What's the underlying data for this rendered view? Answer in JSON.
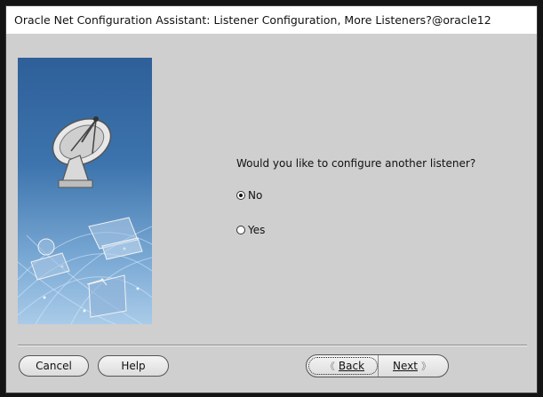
{
  "window": {
    "title": "Oracle Net Configuration Assistant: Listener Configuration, More Listeners?@oracle12"
  },
  "main": {
    "question": "Would you like to configure another listener?",
    "options": [
      {
        "label": "No",
        "selected": true
      },
      {
        "label": "Yes",
        "selected": false
      }
    ]
  },
  "buttons": {
    "cancel": "Cancel",
    "help": "Help",
    "back": "Back",
    "next": "Next"
  },
  "icons": {
    "back_arrow": "double-left-arrow",
    "next_arrow": "double-right-arrow",
    "illustration": "satellite-dish-network-illustration"
  }
}
